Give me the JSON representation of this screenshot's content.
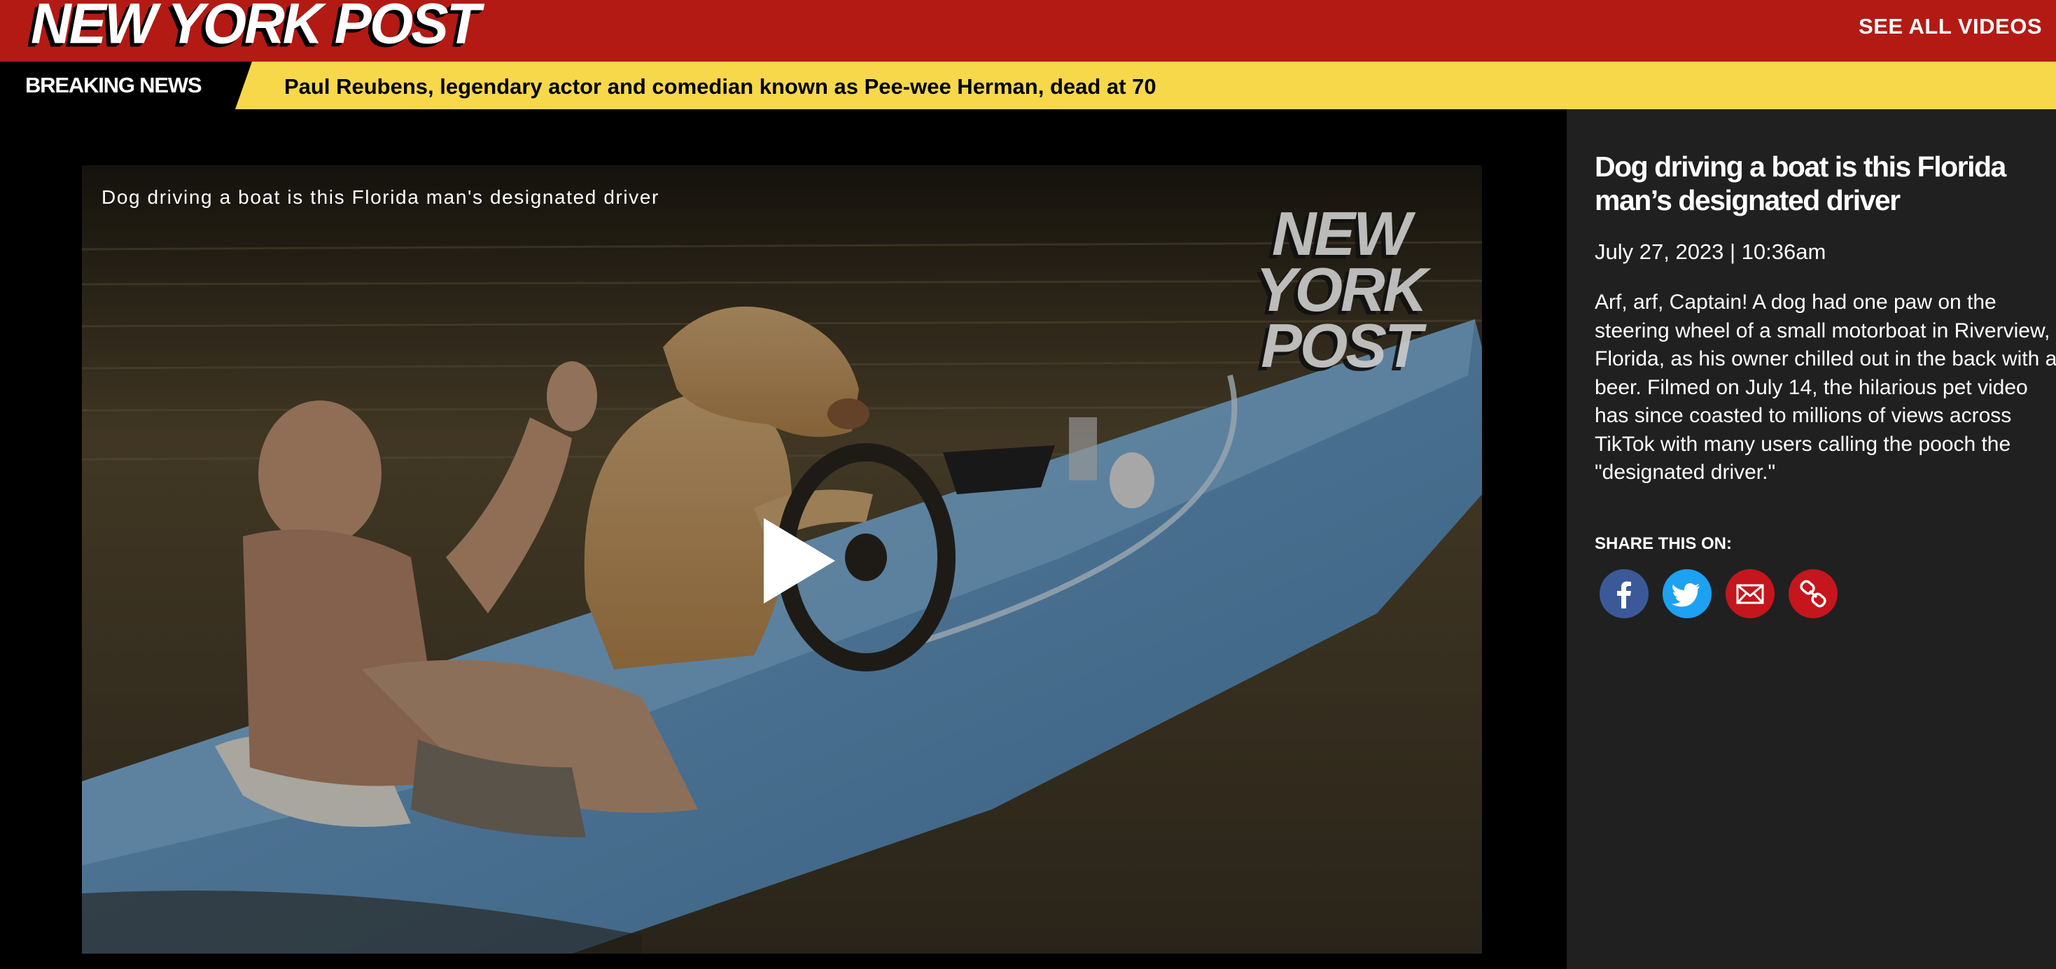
{
  "header": {
    "logo_text": "NEW YORK POST",
    "see_all_label": "SEE ALL VIDEOS",
    "brand_color": "#b31a14"
  },
  "breaking": {
    "label": "BREAKING NEWS",
    "headline": "Paul Reubens, legendary actor and comedian known as Pee-wee Herman, dead at 70",
    "bar_color": "#f6d84a"
  },
  "video": {
    "overlay_title": "Dog driving a boat is this Florida man's designated driver",
    "watermark_lines": [
      "NEW",
      "YORK",
      "POST"
    ],
    "play_icon": "play-icon"
  },
  "article": {
    "title": "Dog driving a boat is this Florida man’s designated driver",
    "date": "July 27, 2023 | 10:36am",
    "body": "Arf, arf, Captain! A dog had one paw on the steering wheel of a small motorboat in Riverview, Florida, as his owner chilled out in the back with a beer. Filmed on July 14, the hilarious pet video has since coasted to millions of views across TikTok with many users calling the pooch the \"designated driver.\""
  },
  "share": {
    "label": "SHARE THIS ON:",
    "buttons": [
      {
        "name": "facebook",
        "icon": "facebook-icon",
        "color": "#3b5998"
      },
      {
        "name": "twitter",
        "icon": "twitter-icon",
        "color": "#1da1f2"
      },
      {
        "name": "email",
        "icon": "email-icon",
        "color": "#c4161c"
      },
      {
        "name": "copy-link",
        "icon": "link-icon",
        "color": "#c4161c"
      }
    ]
  }
}
